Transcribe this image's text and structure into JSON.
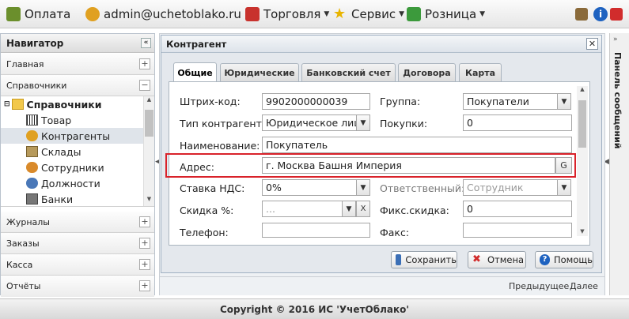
{
  "topbar": {
    "oplata": "Оплата",
    "user": "admin@uchetoblako.ru",
    "trade": "Торговля",
    "service": "Сервис",
    "retail": "Розница"
  },
  "navigator": {
    "title": "Навигатор",
    "sections_top": [
      "Главная",
      "Справочники"
    ],
    "tree_root": "Справочники",
    "tree_items": [
      "Товар",
      "Контрагенты",
      "Склады",
      "Сотрудники",
      "Должности",
      "Банки"
    ],
    "sections_bottom": [
      "Журналы",
      "Заказы",
      "Касса",
      "Отчёты"
    ]
  },
  "dialog": {
    "title": "Контрагент",
    "tabs": [
      "Общие",
      "Юридические",
      "Банковский счет",
      "Договора",
      "Карта"
    ],
    "fields": {
      "barcode_label": "Штрих-код:",
      "barcode_value": "9902000000039",
      "group_label": "Группа:",
      "group_value": "Покупатели",
      "type_label": "Тип контрагента:",
      "type_value": "Юридическое лицо",
      "purchases_label": "Покупки:",
      "purchases_value": "0",
      "name_label": "Наименование:",
      "name_value": "Покупатель",
      "address_label": "Адрес:",
      "address_value": "г. Москва Башня Империя",
      "address_btn": "G",
      "vat_label": "Ставка НДС:",
      "vat_value": "0%",
      "responsible_label": "Ответственный:",
      "responsible_placeholder": "Сотрудник",
      "discount_label": "Скидка %:",
      "discount_placeholder": "...",
      "discount_clear": "X",
      "fixdiscount_label": "Фикс.скидка:",
      "fixdiscount_value": "0",
      "phone_label": "Телефон:",
      "fax_label": "Факс:"
    },
    "buttons": {
      "save": "Сохранить",
      "cancel": "Отмена",
      "help": "Помощь"
    }
  },
  "pager": {
    "prev": "Предыдущее",
    "next": "Далее"
  },
  "right_panel": {
    "title": "Панель сообщений"
  },
  "footer": {
    "copyright": "Copyright © 2016 ИС 'УчетОблако'"
  },
  "colors": {
    "highlight": "#d9222a",
    "accent_blue": "#1e62c0"
  }
}
